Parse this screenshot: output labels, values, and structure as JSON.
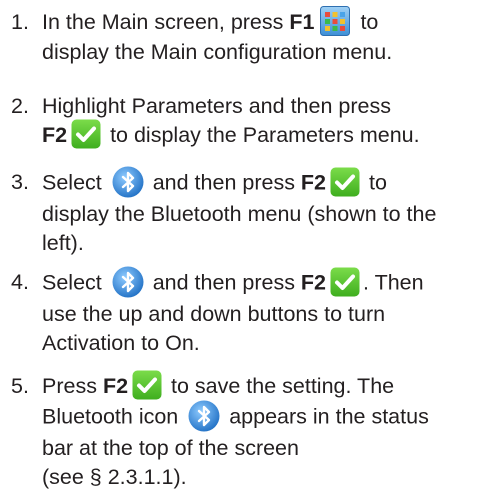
{
  "steps": [
    {
      "number": "1.",
      "parts": {
        "a": "In the Main screen, press ",
        "key": "F1",
        "b": " to",
        "c": "display the Main configuration menu."
      }
    },
    {
      "number": "2.",
      "parts": {
        "a": "Highlight Parameters and then press",
        "key": "F2",
        "b": " to display the Parameters menu."
      }
    },
    {
      "number": "3.",
      "parts": {
        "a": "Select ",
        "b": " and then press ",
        "key": "F2",
        "c": " to",
        "d": "display the Bluetooth menu (shown to the",
        "e": "left)."
      }
    },
    {
      "number": "4.",
      "parts": {
        "a": "Select ",
        "b": " and then press ",
        "key": "F2",
        "c": ". Then",
        "d": "use the up and down buttons to turn",
        "e": "Activation to On."
      }
    },
    {
      "number": "5.",
      "parts": {
        "a": "Press ",
        "key": "F2",
        "b": " to save the setting. The",
        "c": "Bluetooth icon ",
        "d": " appears in the status",
        "e": "bar at the top of the screen",
        "f": "(see § 2.3.1.1)."
      }
    }
  ],
  "icons": {
    "main_menu": "grid-icon",
    "validate": "check-icon",
    "bluetooth": "bluetooth-icon"
  },
  "colors": {
    "text": "#231f20",
    "check_green": "#52c41a",
    "bluetooth_blue": "#2f8fe0"
  }
}
